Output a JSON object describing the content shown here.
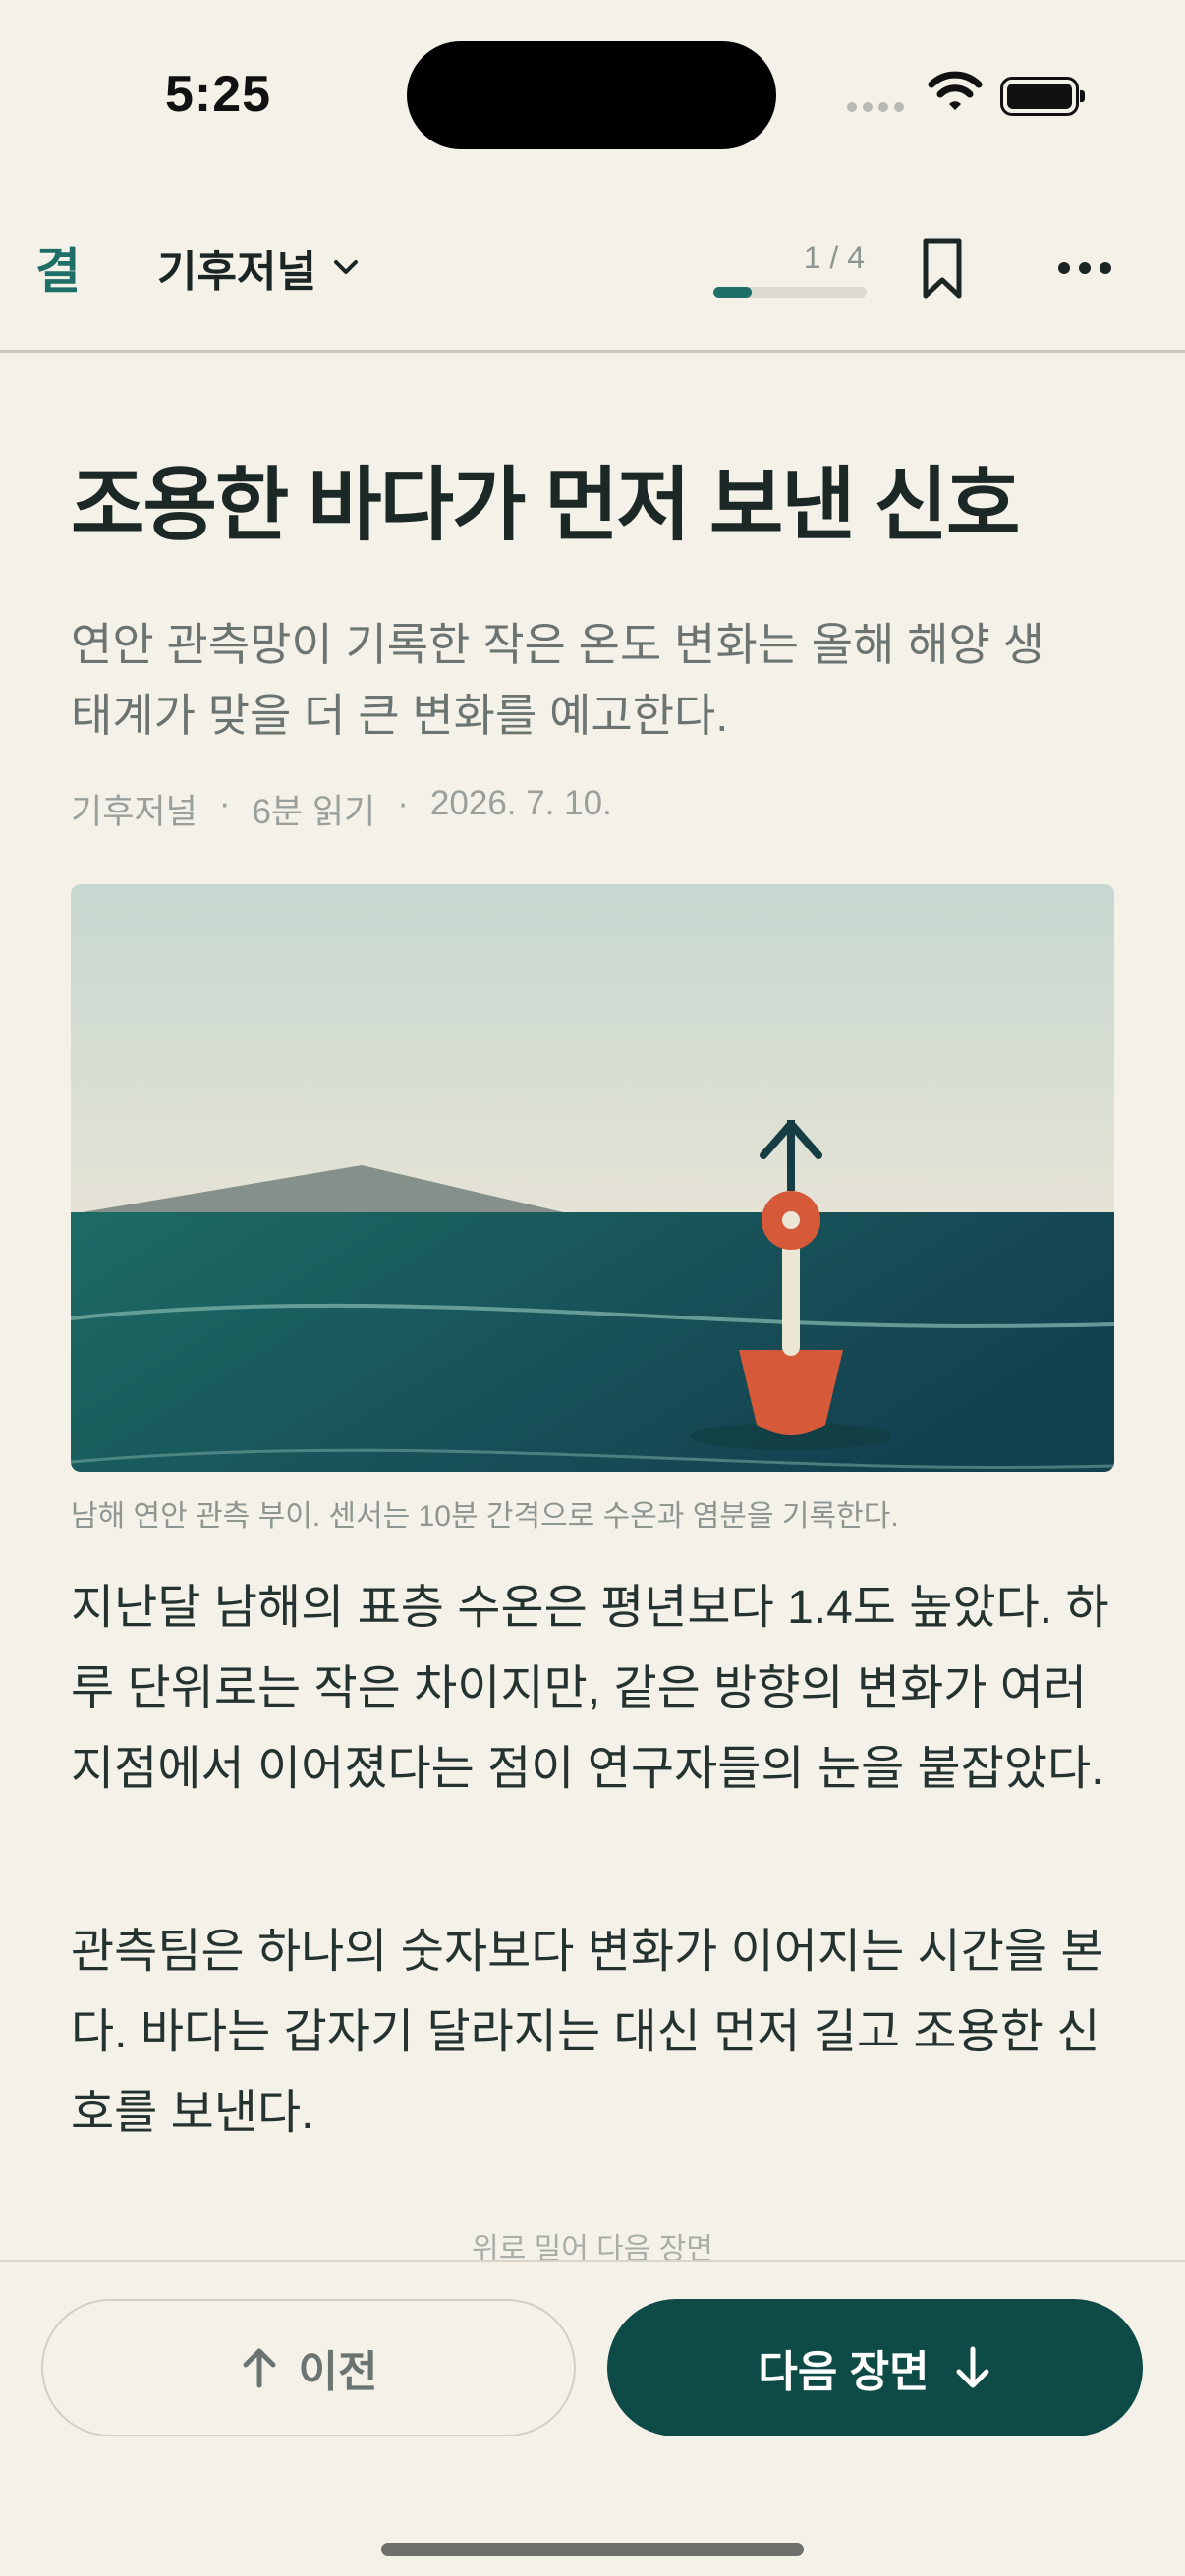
{
  "status": {
    "time": "5:25"
  },
  "nav": {
    "logo": "결",
    "journal_name": "기후저널",
    "progress_label": "1 / 4",
    "progress_fraction": 0.25
  },
  "article": {
    "title": "조용한 바다가 먼저 보낸 신호",
    "subtitle": "연안 관측망이 기록한 작은 온도 변화는 올해 해양 생태계가 맞을 더 큰 변화를 예고한다.",
    "meta": {
      "journal": "기후저널",
      "read_time": "6분 읽기",
      "date": "2026. 7. 10."
    },
    "caption": "남해 연안 관측 부이. 센서는 10분 간격으로 수온과 염분을 기록한다.",
    "paragraphs": [
      "지난달 남해의 표층 수온은 평년보다 1.4도 높았다. 하루 단위로는 작은 차이지만, 같은 방향의 변화가 여러 지점에서 이어졌다는 점이 연구자들의 눈을 붙잡았다.",
      "관측팀은 하나의 숫자보다 변화가 이어지는 시간을 본다. 바다는 갑자기 달라지는 대신 먼저 길고 조용한 신호를 보낸다."
    ]
  },
  "footer": {
    "hint": "위로 밀어 다음 장면",
    "prev_label": "이전",
    "next_label": "다음 장면"
  },
  "colors": {
    "accent": "#1d6f68",
    "primary_button": "#0f4b46",
    "buoy": "#d65a3a",
    "background": "#f4f1e8"
  }
}
